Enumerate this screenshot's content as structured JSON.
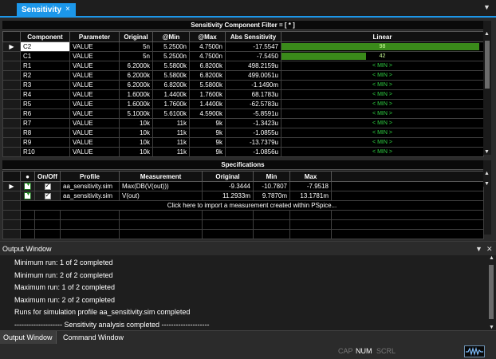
{
  "tab": {
    "title": "Sensitivity",
    "close": "×"
  },
  "sensitivity": {
    "filter_title": "Sensitivity Component Filter = [ * ]",
    "columns": [
      "Component",
      "Parameter",
      "Original",
      "@Min",
      "@Max",
      "Abs Sensitivity",
      "Linear"
    ],
    "rows": [
      {
        "component": "C2",
        "parameter": "VALUE",
        "original": "5n",
        "min": "5.2500n",
        "max": "4.7500n",
        "abs": "-17.5547",
        "linear": "98",
        "linear_fraction": 0.98
      },
      {
        "component": "C1",
        "parameter": "VALUE",
        "original": "5n",
        "min": "5.2500n",
        "max": "4.7500n",
        "abs": "-7.5450",
        "linear": "42",
        "linear_fraction": 0.42
      },
      {
        "component": "R1",
        "parameter": "VALUE",
        "original": "6.2000k",
        "min": "5.5800k",
        "max": "6.8200k",
        "abs": "498.2159u",
        "linear": "< MIN >"
      },
      {
        "component": "R2",
        "parameter": "VALUE",
        "original": "6.2000k",
        "min": "5.5800k",
        "max": "6.8200k",
        "abs": "499.0051u",
        "linear": "< MIN >"
      },
      {
        "component": "R3",
        "parameter": "VALUE",
        "original": "6.2000k",
        "min": "6.8200k",
        "max": "5.5800k",
        "abs": "-1.1490m",
        "linear": "< MIN >"
      },
      {
        "component": "R4",
        "parameter": "VALUE",
        "original": "1.6000k",
        "min": "1.4400k",
        "max": "1.7600k",
        "abs": "68.1783u",
        "linear": "< MIN >"
      },
      {
        "component": "R5",
        "parameter": "VALUE",
        "original": "1.6000k",
        "min": "1.7600k",
        "max": "1.4400k",
        "abs": "-62.5783u",
        "linear": "< MIN >"
      },
      {
        "component": "R6",
        "parameter": "VALUE",
        "original": "5.1000k",
        "min": "5.6100k",
        "max": "4.5900k",
        "abs": "-5.8591u",
        "linear": "< MIN >"
      },
      {
        "component": "R7",
        "parameter": "VALUE",
        "original": "10k",
        "min": "11k",
        "max": "9k",
        "abs": "-1.3423u",
        "linear": "< MIN >"
      },
      {
        "component": "R8",
        "parameter": "VALUE",
        "original": "10k",
        "min": "11k",
        "max": "9k",
        "abs": "-1.0855u",
        "linear": "< MIN >"
      },
      {
        "component": "R9",
        "parameter": "VALUE",
        "original": "10k",
        "min": "11k",
        "max": "9k",
        "abs": "-13.7379u",
        "linear": "< MIN >"
      },
      {
        "component": "R10",
        "parameter": "VALUE",
        "original": "10k",
        "min": "11k",
        "max": "9k",
        "abs": "-1.0856u",
        "linear": "< MIN >"
      }
    ]
  },
  "specifications": {
    "title": "Specifications",
    "columns": [
      "●",
      "On/Off",
      "Profile",
      "Measurement",
      "Original",
      "Min",
      "Max"
    ],
    "rows": [
      {
        "profile": "aa_sensitivity.sim",
        "measurement": "Max(DB(V(out)))",
        "original": "-9.3444",
        "min": "-10.7807",
        "max": "-7.9518"
      },
      {
        "profile": "aa_sensitivity.sim",
        "measurement": "V(out)",
        "original": "11.2933m",
        "min": "9.7870m",
        "max": "13.1781m"
      }
    ],
    "import_text": "Click here to import a measurement created within PSpice..."
  },
  "output": {
    "title": "Output Window",
    "lines": [
      "Minimum run: 1 of 2 completed",
      "Minimum run: 2 of 2 completed",
      "Maximum run: 1 of 2 completed",
      "Maximum run: 2 of 2 completed",
      "Runs for simulation profile aa_sensitivity.sim completed",
      "-------------------- Sensitivity analysis completed --------------------"
    ]
  },
  "bottom_tabs": [
    "Output Window",
    "Command Window"
  ],
  "status": {
    "cap": "CAP",
    "num": "NUM",
    "scrl": "SCRL"
  },
  "colors": {
    "accent": "#1c97ea",
    "bar": "#3a8a1a",
    "min_text": "#2ecc40"
  }
}
